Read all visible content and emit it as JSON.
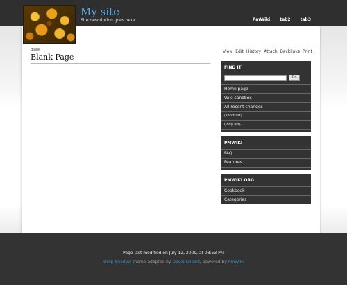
{
  "header": {
    "site_title": "My site",
    "site_description": "Site description goes here.",
    "tabs": [
      "PmWiki",
      "tab2",
      "tab3"
    ]
  },
  "page": {
    "group": "Blank",
    "title": "Blank Page",
    "actions": [
      "View",
      "Edit",
      "History",
      "Attach",
      "Backlinks",
      "Print"
    ]
  },
  "sidebar": {
    "find": {
      "heading": "FIND IT",
      "search_value": "",
      "go_label": "Go"
    },
    "nav": [
      "Home page",
      "Wiki sandbox",
      "All recent changes",
      "(short list)",
      "(long list)"
    ],
    "pmwiki": {
      "heading": "PMWIKI",
      "items": [
        "FAQ",
        "Features"
      ]
    },
    "pmwiki_org": {
      "heading": "PMWIKI.ORG",
      "items": [
        "Cookbook",
        "Categories"
      ]
    }
  },
  "footer": {
    "last_modified": "Page last modified on July 12, 2009, at 03:53 PM",
    "theme_name": "Drop Shadow",
    "theme_text": " theme adapted by ",
    "author": "David Gilbert",
    "powered_text": ", powered by ",
    "powered_by": "PmWiki"
  },
  "colors": {
    "header_bg": "#2f2f2f",
    "title_blue": "#5aa7e0",
    "sidebar_bg": "#333333",
    "link_teal": "#2f8fbd"
  }
}
